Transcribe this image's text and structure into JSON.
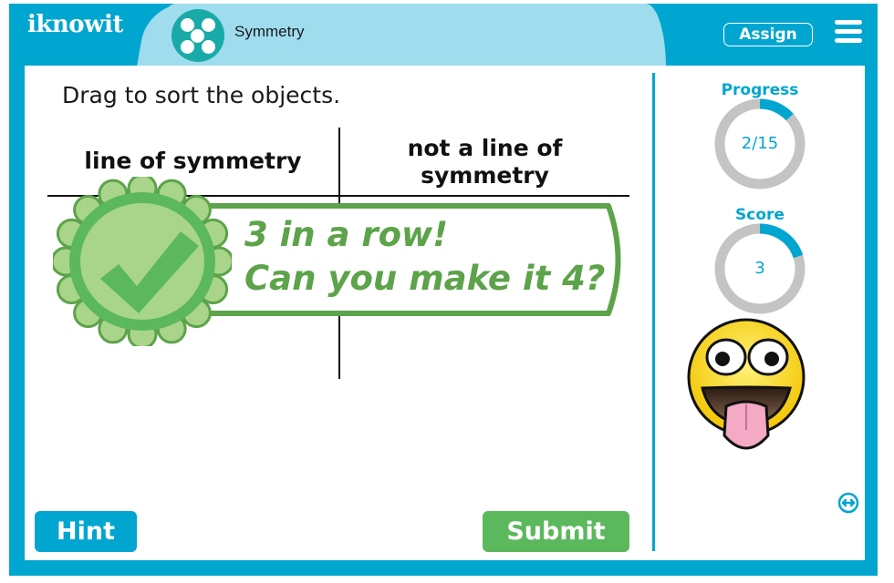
{
  "header": {
    "logo": "iknowit",
    "topic_title": "Symmetry",
    "topic_icon": "five-dots-icon",
    "assign_label": "Assign",
    "menu_icon": "hamburger-menu-icon"
  },
  "main": {
    "instruction": "Drag to sort the objects.",
    "columns": [
      {
        "label": "line of symmetry"
      },
      {
        "label": "not a line of symmetry",
        "lines": [
          "not a line of",
          "symmetry"
        ]
      }
    ],
    "feedback": {
      "line1": "3 in a row!",
      "line2": "Can you make it 4?",
      "icon": "checkmark-badge-icon"
    },
    "hint_label": "Hint",
    "submit_label": "Submit"
  },
  "sidebar": {
    "progress": {
      "label": "Progress",
      "text": "2/15",
      "current": 2,
      "total": 15,
      "fraction": 0.133
    },
    "score": {
      "label": "Score",
      "text": "3",
      "value": 3,
      "fraction": 0.2
    },
    "mascot": "silly-face-emoji",
    "expand_icon": "expand-horizontal-icon"
  },
  "colors": {
    "brand_blue": "#00a6cf",
    "tab_light_blue": "#9edcee",
    "topic_teal": "#19aaa8",
    "success_green": "#5cb85c",
    "feedback_green": "#5ca34a",
    "badge_light_green": "#a8d58a",
    "ring_gray": "#c4c4c4"
  }
}
